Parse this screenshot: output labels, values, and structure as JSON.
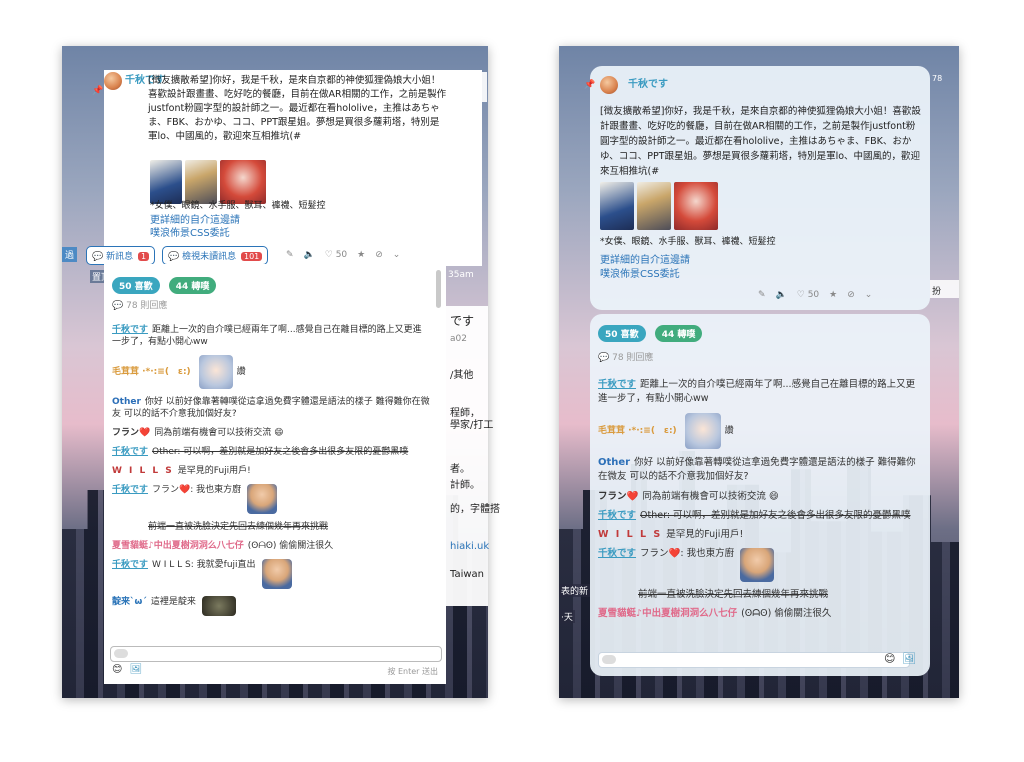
{
  "left": {
    "bg_fragments": [
      "です",
      "a02",
      "/其他",
      "程師，",
      "學家/打工",
      "者。",
      "計師。",
      "的，字體搭",
      "hiaki.uk",
      "Taiwan",
      "35am",
      "置頂",
      "過"
    ],
    "post": {
      "author": "千秋です",
      "text": "[徵友擴散希望]你好，我是千秋，是來自京都的神使狐狸偽娘大小姐！喜歡設計跟畫畫、吃好吃的餐廳，目前在做AR相關的工作，之前是製作justfont粉圓字型的設計師之一。最近都在看hololive，主推はあちゃま、FBK、おかゆ、ココ、PPT跟星姐。夢想是買很多蘿莉塔，特別是軍lo、中國風的，歡迎來互相推坑(#",
      "tags": "*女僕、眼鏡、水手服、獸耳、褲襪、短髮控",
      "link1": "更詳細的自介這邊請",
      "link2": "噗浪佈景CSS委託",
      "new_msg": "新訊息",
      "new_msg_count": "1",
      "unread_msg": "檢視未讀訊息",
      "unread_count": "101",
      "likes_small": "50"
    },
    "pills": {
      "likes": "50 喜歡",
      "replurks": "44 轉噗"
    },
    "reply_count": "78 則回應",
    "comments": [
      {
        "who": "千秋です",
        "text": "距離上一次的自介噗已經兩年了啊...感覺自己在離目標的路上又更進一步了，有點小開心ww"
      },
      {
        "who": "毛茸茸 ·*·:≡(　ε:)",
        "text": "讚"
      },
      {
        "who": "Other",
        "text": "你好 以前好像靠著轉噗從這拿過免費字體還是語法的樣子 難得難你在微友 可以的話不介意我加個好友?"
      },
      {
        "who": "フラン❤️",
        "text": "同為前端有機會可以技術交流"
      },
      {
        "who": "千秋です",
        "text": "Other: 可以啊，差別就是加好友之後會多出很多友限的憂鬱黑噗"
      },
      {
        "who": "W I L L S",
        "text": "是罕見的Fuji用戶!"
      },
      {
        "who": "千秋です",
        "text": "フラン❤️: 我也東方廚"
      },
      {
        "who": "",
        "text": "前端一直被洗臉決定先回去練個幾年再來挑戰"
      },
      {
        "who": "夏雪貓蜓♪中出夏樹洞洞么八七仔",
        "text": "偷偷關注很久"
      },
      {
        "who": "千秋です",
        "text": "W I L L S: 我就愛fuji直出"
      },
      {
        "who": "靛来`ω´",
        "text": "這裡是靛来"
      }
    ],
    "enter_hint": "按 Enter 送出"
  },
  "right": {
    "bg_fragments": [
      "78",
      "扮",
      "表的新",
      "·天"
    ],
    "post": {
      "author": "千秋です",
      "text": "[徵友擴散希望]你好，我是千秋，是來自京都的神使狐狸偽娘大小姐！喜歡設計跟畫畫、吃好吃的餐廳，目前在做AR相關的工作，之前是製作justfont粉圓字型的設計師之一。最近都在看hololive，主推はあちゃま、FBK、おかゆ、ココ、PPT跟星姐。夢想是買很多蘿莉塔，特別是軍lo、中國風的，歡迎來互相推坑(#",
      "tags": "*女僕、眼鏡、水手服、獸耳、褲襪、短髮控",
      "link1": "更詳細的自介這邊請",
      "link2": "噗浪佈景CSS委託",
      "likes_small": "50"
    },
    "pills": {
      "likes": "50 喜歡",
      "replurks": "44 轉噗"
    },
    "reply_count": "78 則回應",
    "comments": [
      {
        "who": "千秋です",
        "text": "距離上一次的自介噗已經兩年了啊...感覺自己在離目標的路上又更進一步了，有點小開心ww"
      },
      {
        "who": "毛茸茸 ·*·:≡(　ε:)",
        "text": "讚"
      },
      {
        "who": "Other",
        "text": "你好 以前好像靠著轉噗從這拿過免費字體還是語法的樣子 難得難你在微友 可以的話不介意我加個好友?"
      },
      {
        "who": "フラン❤️",
        "text": "同為前端有機會可以技術交流"
      },
      {
        "who": "千秋です",
        "text": "Other: 可以啊，差別就是加好友之後會多出很多友限的憂鬱黑噗"
      },
      {
        "who": "W I L L S",
        "text": "是罕見的Fuji用戶!"
      },
      {
        "who": "千秋です",
        "text": "フラン❤️: 我也東方廚"
      },
      {
        "who": "",
        "text": "前端一直被洗臉決定先回去練個幾年再來挑戰"
      },
      {
        "who": "夏雪貓蜓♪中出夏樹洞洞么八七仔",
        "text": "偷偷關注很久"
      }
    ]
  }
}
